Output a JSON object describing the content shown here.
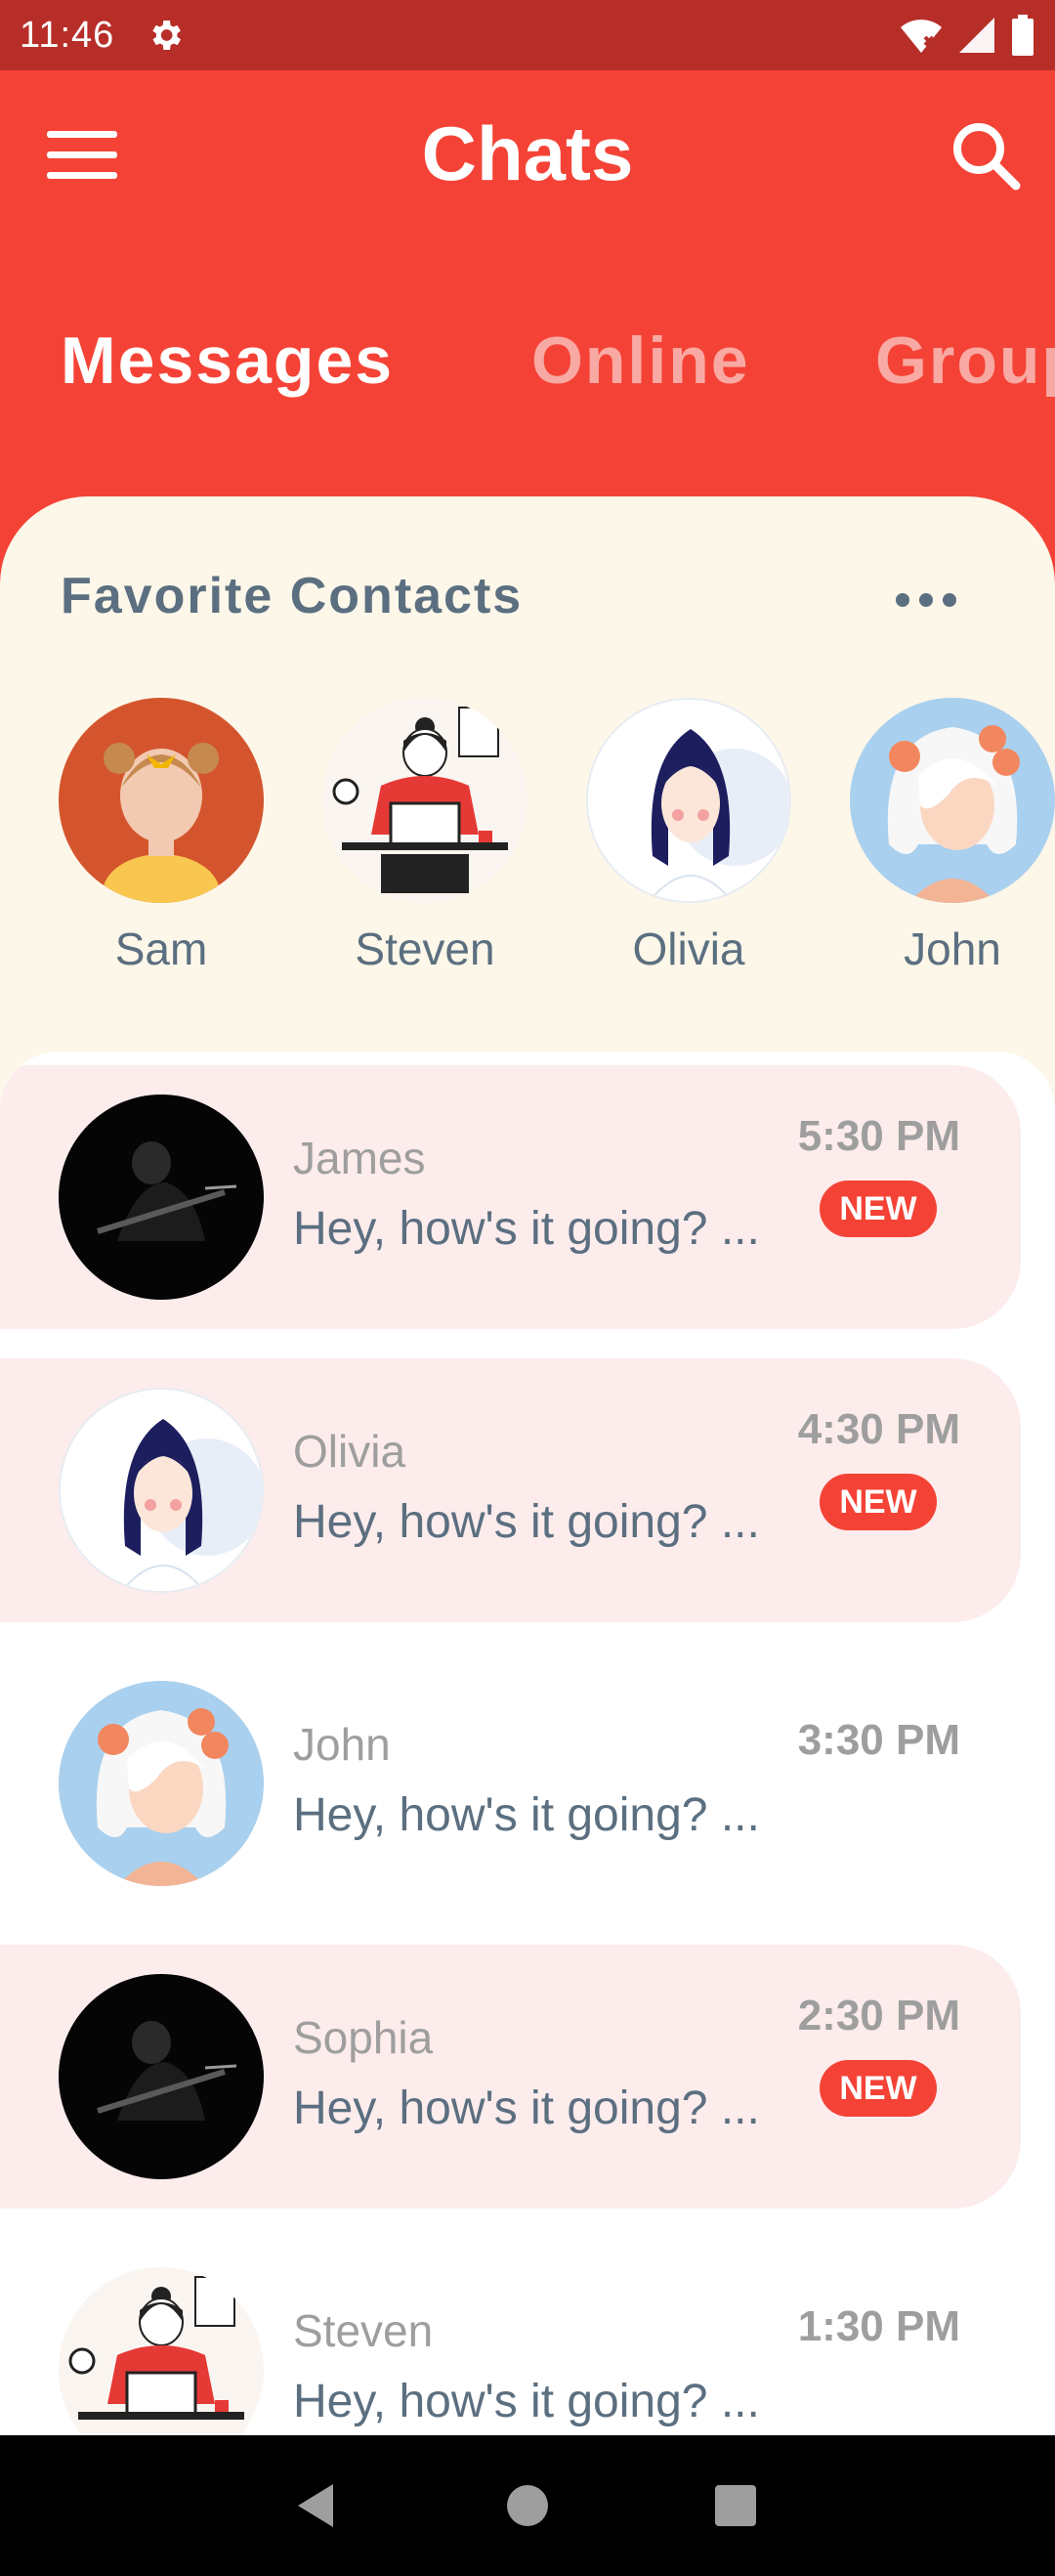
{
  "status_bar": {
    "time": "11:46"
  },
  "app_bar": {
    "title": "Chats"
  },
  "tabs": [
    {
      "label": "Messages"
    },
    {
      "label": "Online"
    },
    {
      "label": "Groups"
    }
  ],
  "favorites": {
    "title": "Favorite Contacts",
    "contacts": [
      {
        "name": "Sam"
      },
      {
        "name": "Steven"
      },
      {
        "name": "Olivia"
      },
      {
        "name": "John"
      }
    ]
  },
  "chats": [
    {
      "name": "James",
      "message": "Hey, how's it going? ...",
      "time": "5:30 PM",
      "badge": "NEW"
    },
    {
      "name": "Olivia",
      "message": "Hey, how's it going? ...",
      "time": "4:30 PM",
      "badge": "NEW"
    },
    {
      "name": "John",
      "message": "Hey, how's it going? ...",
      "time": "3:30 PM",
      "badge": ""
    },
    {
      "name": "Sophia",
      "message": "Hey, how's it going? ...",
      "time": "2:30 PM",
      "badge": "NEW"
    },
    {
      "name": "Steven",
      "message": "Hey, how's it going? ...",
      "time": "1:30 PM",
      "badge": ""
    }
  ],
  "colors": {
    "primary": "#F44336",
    "status_bar": "#B72E28",
    "sheet": "#FDF7E9",
    "unread_row": "#FDECEC",
    "text_slate": "#5B6F80"
  }
}
